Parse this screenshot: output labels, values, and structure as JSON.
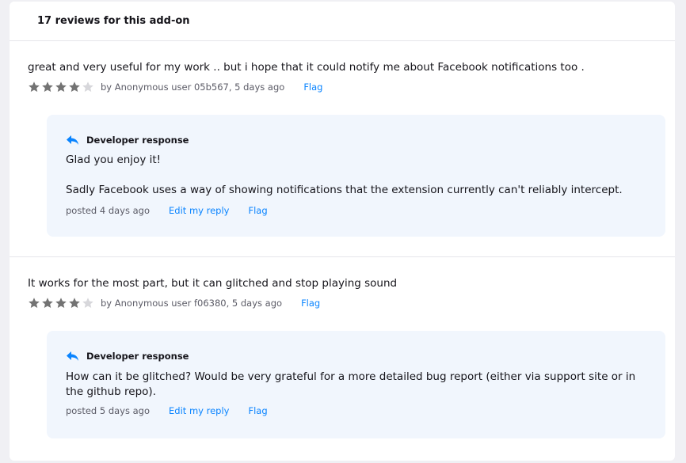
{
  "header": {
    "title": "17 reviews for this add-on"
  },
  "colors": {
    "star_filled": "#737373",
    "star_empty": "#d7d7db",
    "link": "#0a84ff",
    "dev_bg": "#f1f6fd"
  },
  "reviews": [
    {
      "body": "great and very useful for my work .. but i hope that it could notify me about Facebook notifications too .",
      "rating": 4,
      "byline": "by Anonymous user 05b567, 5 days ago",
      "flag_label": "Flag",
      "response": {
        "heading": "Developer response",
        "paragraphs": [
          "Glad you enjoy it!",
          "Sadly Facebook uses a way of showing notifications that the extension currently can't reliably intercept."
        ],
        "posted": "posted 4 days ago",
        "edit_label": "Edit my reply",
        "flag_label": "Flag"
      }
    },
    {
      "body": "It works for the most part, but it can glitched and stop playing sound",
      "rating": 4,
      "byline": "by Anonymous user f06380, 5 days ago",
      "flag_label": "Flag",
      "response": {
        "heading": "Developer response",
        "paragraphs": [
          "How can it be glitched? Would be very grateful for a more detailed bug report (either via support site or in the github repo)."
        ],
        "posted": "posted 5 days ago",
        "edit_label": "Edit my reply",
        "flag_label": "Flag"
      }
    }
  ]
}
